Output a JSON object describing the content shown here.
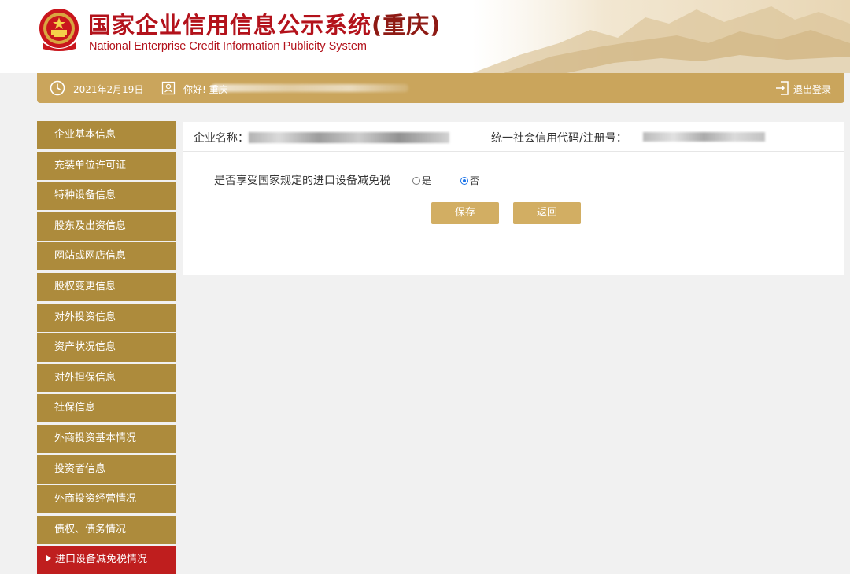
{
  "header": {
    "title": "国家企业信用信息公示系统",
    "region": "(重庆)",
    "subtitle": "National Enterprise Credit Information Publicity System"
  },
  "infobar": {
    "date": "2021年2月19日",
    "greeting": "你好! 重庆",
    "logout_label": "退出登录",
    "icons": [
      "clock-icon",
      "user-icon",
      "logout-icon"
    ]
  },
  "sidebar": {
    "items": [
      {
        "label": "企业基本信息"
      },
      {
        "label": "充装单位许可证"
      },
      {
        "label": "特种设备信息"
      },
      {
        "label": "股东及出资信息"
      },
      {
        "label": "网站或网店信息"
      },
      {
        "label": "股权变更信息"
      },
      {
        "label": "对外投资信息"
      },
      {
        "label": "资产状况信息"
      },
      {
        "label": "对外担保信息"
      },
      {
        "label": "社保信息"
      },
      {
        "label": "外商投资基本情况"
      },
      {
        "label": "投资者信息"
      },
      {
        "label": "外商投资经营情况"
      },
      {
        "label": "债权、债务情况"
      },
      {
        "label": "进口设备减免税情况",
        "active": true
      }
    ]
  },
  "main": {
    "company_name_label": "企业名称：",
    "credit_code_label": "统一社会信用代码/注册号：",
    "question": "是否享受国家规定的进口设备减免税",
    "options": [
      {
        "label": "是",
        "checked": false
      },
      {
        "label": "否",
        "checked": true
      }
    ],
    "save_label": "保存",
    "back_label": "返回"
  },
  "colors": {
    "title_red": "#b3121b",
    "bar_gold": "#caa55c",
    "nav_gold": "#ad8b3c",
    "nav_active_red": "#bf1e1e",
    "button_gold": "#d2ae63"
  }
}
